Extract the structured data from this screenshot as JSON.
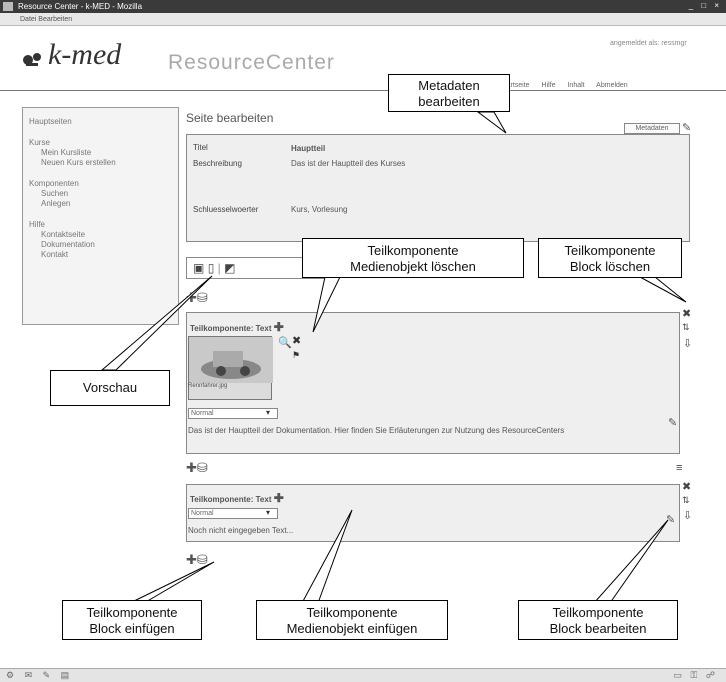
{
  "window": {
    "title": "Resource Center - k-MED - Mozilla",
    "menu": "Datei  Bearbeiten"
  },
  "header": {
    "brand": "ResourceCenter",
    "user_line": "angemeldet als: ressmgr",
    "nav": [
      "Startseite",
      "Hilfe Inhalt",
      "Abmelden"
    ]
  },
  "sidebar": {
    "title": "Hauptseiten",
    "sections": [
      {
        "head": "Kurse",
        "items": [
          "Mein Kursliste",
          "Neuen Kurs erstellen"
        ]
      },
      {
        "head": "Komponenten",
        "items": [
          "Suchen",
          "Anlegen"
        ]
      },
      {
        "head": "Hilfe",
        "items": [
          "Kontaktseite",
          "Dokumentation",
          "Kontakt"
        ]
      }
    ]
  },
  "page": {
    "title": "Seite bearbeiten",
    "meta_button": "Metadaten",
    "meta": {
      "fields": [
        {
          "label": "Titel",
          "value": "Hauptteil"
        },
        {
          "label": "Beschreibung",
          "value": "Das ist der Hauptteil des Kurses"
        },
        {
          "label": "Schluesselwoerter",
          "value": "Kurs, Vorlesung"
        }
      ]
    },
    "blocks": [
      {
        "head": "Teilkomponente: Text",
        "thumb_caption": "Rennfahrer.jpg",
        "select": "Normal",
        "description": "Das ist der Hauptteil der Dokumentation. Hier finden Sie Erläuterungen zur Nutzung des ResourceCenters"
      },
      {
        "head": "Teilkomponente: Text",
        "select": "Normal",
        "description": "Noch nicht eingegeben Text..."
      }
    ]
  },
  "callouts": {
    "metadaten": "Metadaten\nbearbeiten",
    "medien_loeschen": "Teilkomponente\nMedienobjekt  löschen",
    "block_loeschen": "Teilkomponente\nBlock löschen",
    "vorschau": "Vorschau",
    "block_einfuegen": "Teilkomponente\nBlock einfügen",
    "medien_einfuegen": "Teilkomponente\nMedienobjekt einfügen",
    "block_bearbeiten": "Teilkomponente\nBlock bearbeiten"
  },
  "colors": {
    "titlebar": "#3a3a3a",
    "panel": "#efefef",
    "border": "#888888"
  }
}
